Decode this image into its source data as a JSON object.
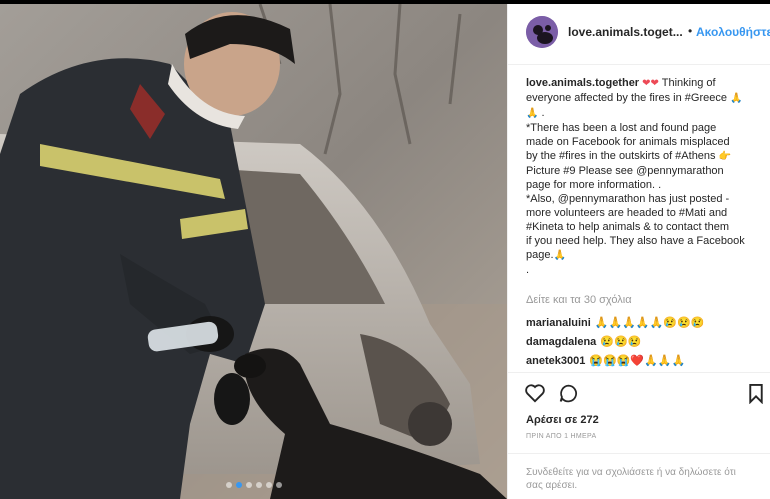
{
  "post": {
    "username": "love.animals.toget...",
    "follow_label": "Ακολουθήστε",
    "separator": "•"
  },
  "caption": {
    "username": "love.animals.together",
    "lines": [
      "Thinking of",
      "everyone affected by the fires in #Greece",
      ".",
      "*There has been a lost and found page",
      "made on Facebook for animals misplaced",
      "by the #fires in the outskirts of #Athens",
      "Picture #9    Please see @pennymarathon",
      "page for more information. .",
      "*Also, @pennymarathon has just posted -",
      "more volunteers are headed to #Mati and",
      "#Kineta to help animals & to contact them",
      "if you need help. They also have a Facebook",
      "page.",
      "."
    ]
  },
  "view_all_comments": "Δείτε και τα 30 σχόλια",
  "comments": [
    {
      "user": "marianaluini",
      "text": "🙏🙏🙏🙏🙏😢😢😢"
    },
    {
      "user": "damagdalena",
      "text": "😢😢😢"
    },
    {
      "user": "anetek3001",
      "text": "😭😭😭❤️🙏🙏🙏"
    }
  ],
  "likes": "Αρέσει σε 272",
  "time": "ΠΡΙΝ ΑΠΟ 1 ΗΜΕΡΑ",
  "login_prompt": "Συνδεθείτε για να σχολιάσετε ή να δηλώσετε ότι σας αρέσει.",
  "icons": {
    "like": "heart-outline-icon",
    "comment": "speech-bubble-icon",
    "save": "bookmark-icon"
  },
  "colors": {
    "accent": "#3897f0",
    "muted": "#999999",
    "text": "#262626",
    "heart": "#ed4956",
    "avatar": "#7b5ea7"
  },
  "photo": {
    "carousel_dots": 6,
    "active_dot": 1
  }
}
